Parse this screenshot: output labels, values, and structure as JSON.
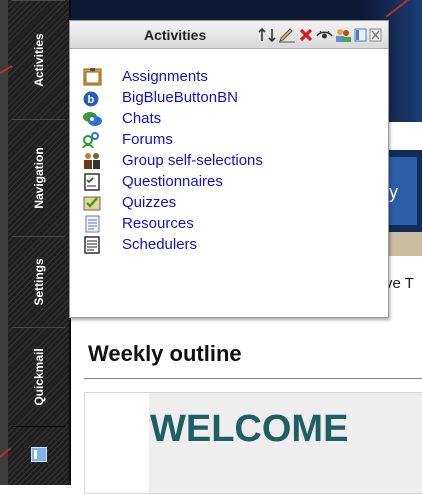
{
  "dock": {
    "tabs": [
      {
        "label": "Activities"
      },
      {
        "label": "Navigation"
      },
      {
        "label": "Settings"
      },
      {
        "label": "Quickmail"
      }
    ],
    "bottom_icon": "dock-toggle-icon"
  },
  "popup": {
    "title": "Activities",
    "header_icons": [
      "move-icon",
      "edit-icon",
      "delete-icon",
      "hide-icon",
      "assign-roles-icon",
      "dock-icon",
      "close-icon"
    ],
    "items": [
      {
        "label": "Assignments",
        "icon": "assignment-icon"
      },
      {
        "label": "BigBlueButtonBN",
        "icon": "bigbluebutton-icon"
      },
      {
        "label": "Chats",
        "icon": "chat-icon"
      },
      {
        "label": "Forums",
        "icon": "forum-icon"
      },
      {
        "label": "Group self-selections",
        "icon": "group-icon"
      },
      {
        "label": "Questionnaires",
        "icon": "questionnaire-icon"
      },
      {
        "label": "Quizzes",
        "icon": "quiz-icon"
      },
      {
        "label": "Resources",
        "icon": "resource-icon"
      },
      {
        "label": "Schedulers",
        "icon": "scheduler-icon"
      }
    ]
  },
  "page": {
    "nav_fragment": "y",
    "peek_text": "ve T",
    "section_heading": "Weekly outline",
    "welcome": "WELCOME"
  },
  "colors": {
    "link": "#1111cc",
    "welcome": "#1f5f64",
    "annotation": "#b5302a"
  }
}
